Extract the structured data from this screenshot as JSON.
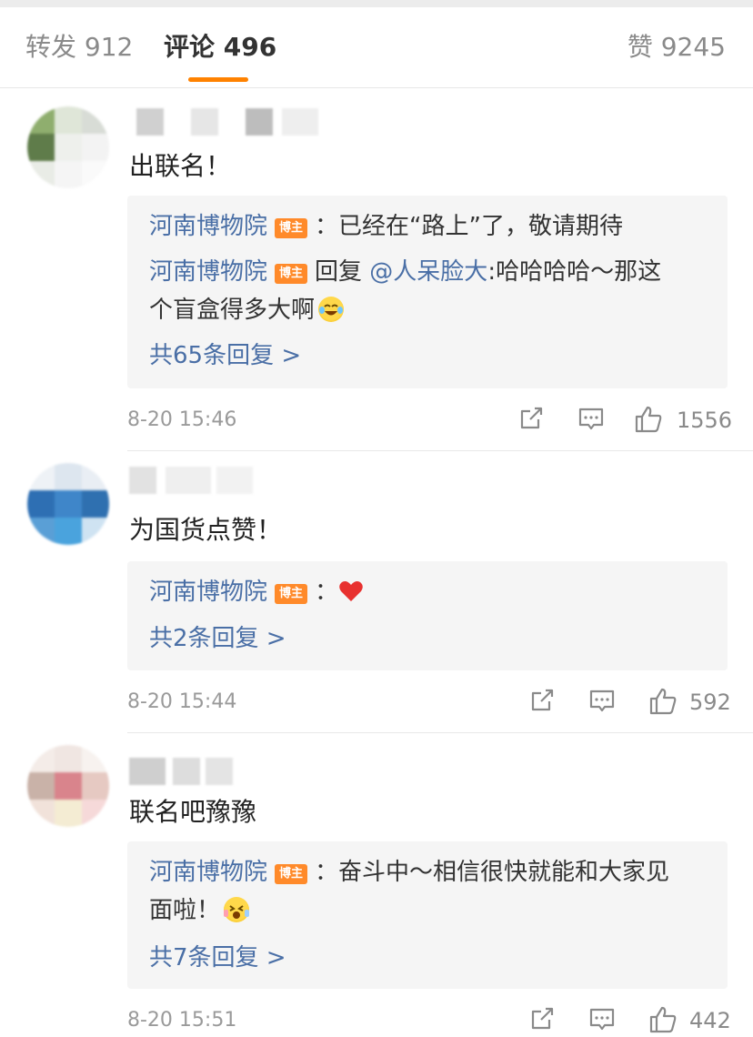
{
  "tabs": {
    "repost_label": "转发",
    "repost_count": "912",
    "comments_label": "评论",
    "comments_count": "496",
    "likes_label": "赞",
    "likes_count": "9245"
  },
  "accent_color": "#ff8200",
  "link_color": "#4a6fa6",
  "comments": [
    {
      "content": "出联名！",
      "replies": [
        {
          "author": "河南博物院",
          "badge": "博主",
          "text": "：已经在“路上”了，敬请期待"
        },
        {
          "author": "河南博物院",
          "badge": "博主",
          "reply_word": "回复",
          "mention": "@人呆脸大",
          "text": ":哈哈哈哈～那这",
          "text2": "个盲盒得多大啊",
          "emoji": "laughing-tears-emoji"
        }
      ],
      "more_replies": "共65条回复 >",
      "time": "8-20 15:46",
      "like_count": "1556"
    },
    {
      "content": "为国货点赞！",
      "replies": [
        {
          "author": "河南博物院",
          "badge": "博主",
          "text": "：",
          "emoji": "heart-emoji"
        }
      ],
      "more_replies": "共2条回复 >",
      "time": "8-20 15:44",
      "like_count": "592"
    },
    {
      "content": "联名吧豫豫",
      "replies": [
        {
          "author": "河南博物院",
          "badge": "博主",
          "text": "：奋斗中～相信很快就能和大家见",
          "text2": "面啦！",
          "emoji": "cheer-emoji"
        }
      ],
      "more_replies": "共7条回复 >",
      "time": "8-20 15:51",
      "like_count": "442"
    }
  ]
}
